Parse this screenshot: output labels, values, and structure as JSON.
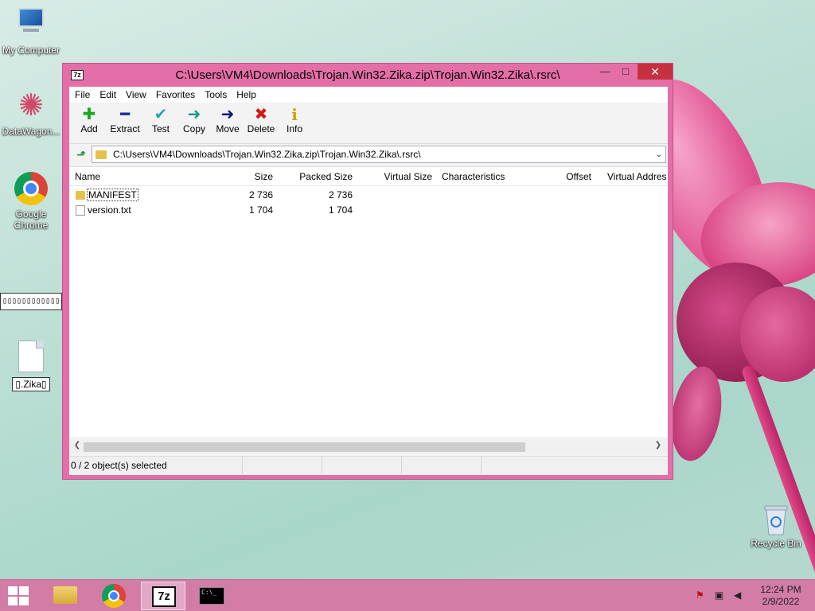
{
  "desktop": {
    "icons": [
      {
        "label": "My Computer"
      },
      {
        "label": "DataWagon..."
      },
      {
        "label": "Google Chrome"
      },
      {
        "label": "▯.Zika▯"
      },
      {
        "label": "Recycle Bin"
      }
    ],
    "strip_text": "▯▯▯▯▯▯▯▯▯▯▯▯▯▯▯▯▯▯"
  },
  "window": {
    "icon_text": "7z",
    "title": "C:\\Users\\VM4\\Downloads\\Trojan.Win32.Zika.zip\\Trojan.Win32.Zika\\.rsrc\\",
    "controls": {
      "minimize": "—",
      "maximize": "□",
      "close": "✕"
    },
    "menu": [
      "File",
      "Edit",
      "View",
      "Favorites",
      "Tools",
      "Help"
    ],
    "toolbar": [
      {
        "label": "Add",
        "icon": "✚",
        "color": "#1fa51f"
      },
      {
        "label": "Extract",
        "icon": "━",
        "color": "#1a2f9a"
      },
      {
        "label": "Test",
        "icon": "✔",
        "color": "#2aa6b0"
      },
      {
        "label": "Copy",
        "icon": "➜",
        "color": "#1a9a8a"
      },
      {
        "label": "Move",
        "icon": "➜",
        "color": "#0a1a7a"
      },
      {
        "label": "Delete",
        "icon": "✖",
        "color": "#d11a1a"
      },
      {
        "label": "Info",
        "icon": "i",
        "color": "#caa400"
      }
    ],
    "address": "C:\\Users\\VM4\\Downloads\\Trojan.Win32.Zika.zip\\Trojan.Win32.Zika\\.rsrc\\",
    "columns": [
      "Name",
      "Size",
      "Packed Size",
      "Virtual Size",
      "Characteristics",
      "Offset",
      "Virtual Addres"
    ],
    "files": [
      {
        "name": "MANIFEST",
        "type": "folder",
        "size": "2 736",
        "packed": "2 736"
      },
      {
        "name": "version.txt",
        "type": "text",
        "size": "1 704",
        "packed": "1 704"
      }
    ],
    "status": "0 / 2 object(s) selected"
  },
  "taskbar": {
    "time": "12:24 PM",
    "date": "2/9/2022",
    "cmd_text": "C:\\_"
  }
}
